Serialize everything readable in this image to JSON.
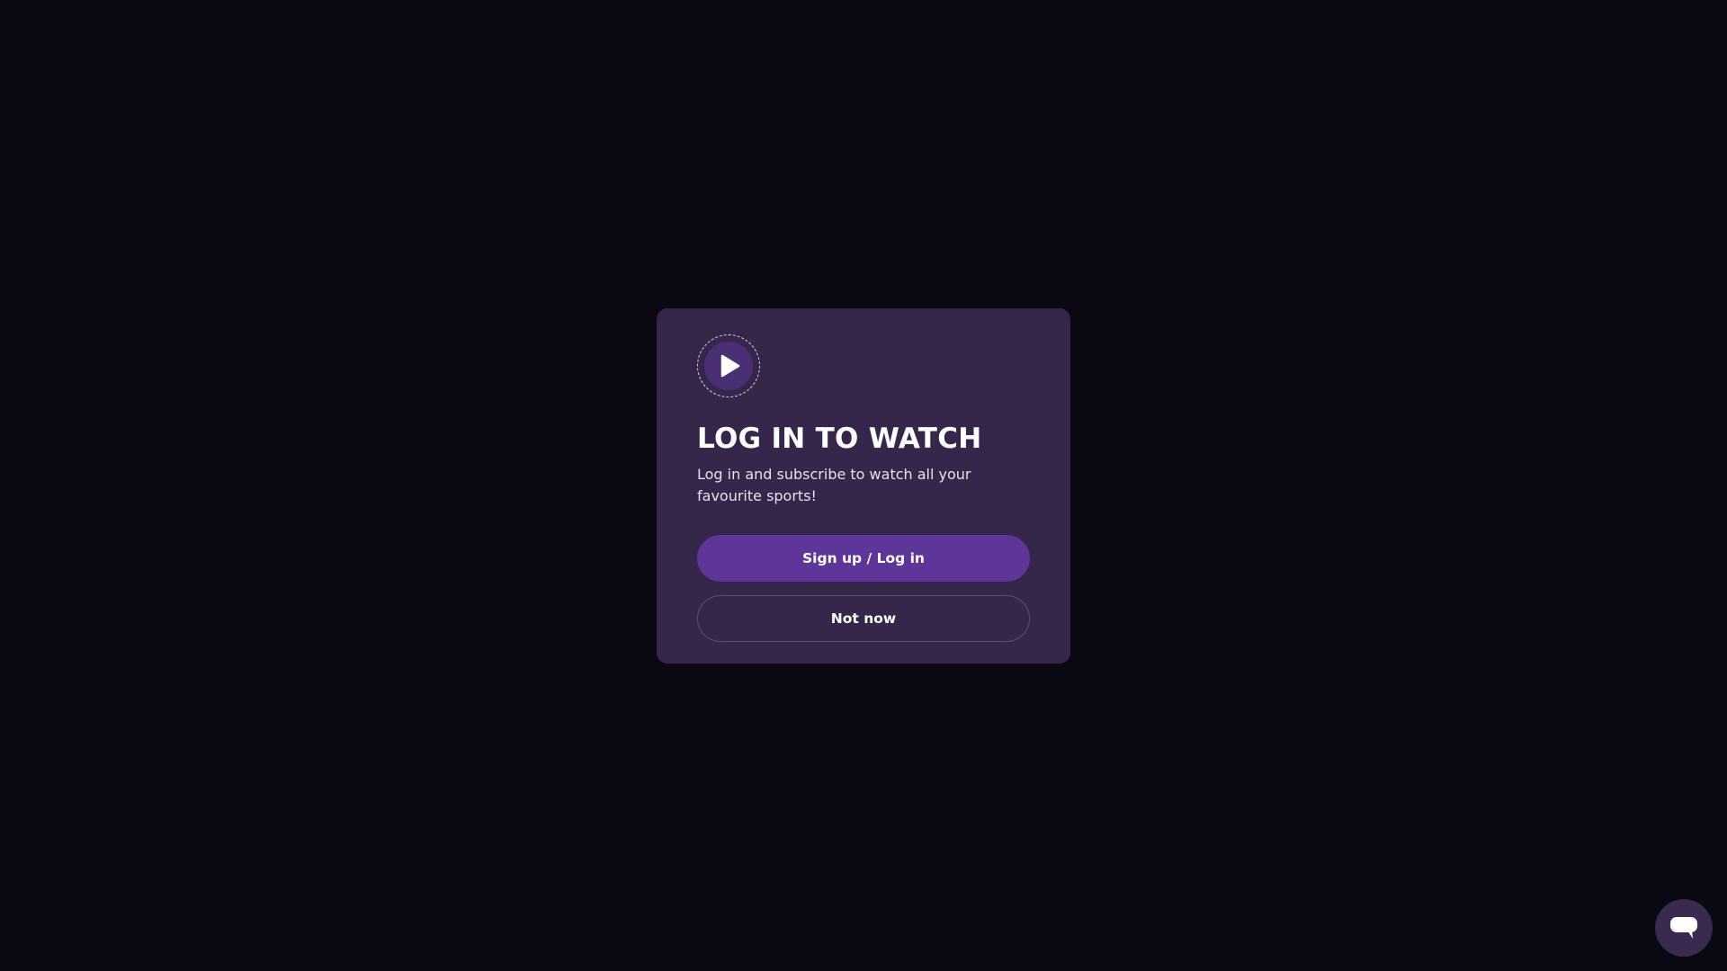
{
  "modal": {
    "icon": "play-icon",
    "title": "LOG IN TO WATCH",
    "subtitle": "Log in and subscribe to watch all your favourite sports!",
    "primary_button_label": "Sign up / Log in",
    "secondary_button_label": "Not now"
  },
  "chat": {
    "icon": "chat-bubble-icon"
  },
  "colors": {
    "page_background": "#0a0810",
    "modal_background": "#36274a",
    "primary_button": "#5e3599",
    "secondary_button_border": "#5c4d72",
    "chat_button": "#3a2a4f"
  }
}
